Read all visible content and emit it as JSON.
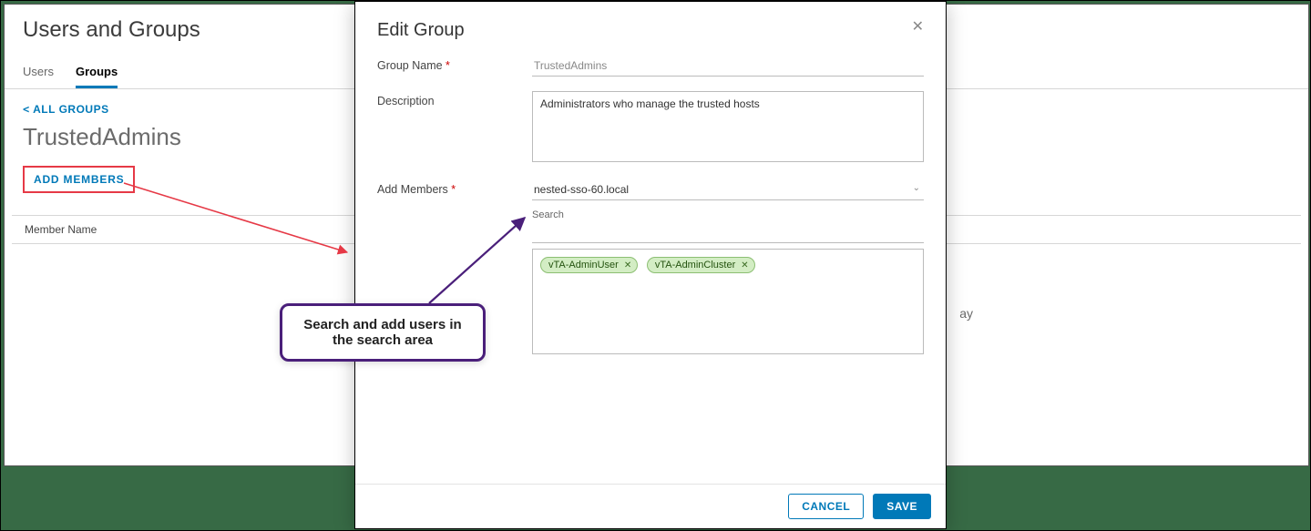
{
  "page": {
    "title": "Users and Groups",
    "tabs": {
      "users": "Users",
      "groups": "Groups"
    },
    "breadcrumb": "ALL GROUPS",
    "group_name": "TrustedAdmins",
    "add_members_btn": "ADD MEMBERS",
    "table": {
      "col_member_name": "Member Name"
    },
    "ghost_text": "ay"
  },
  "modal": {
    "title": "Edit Group",
    "labels": {
      "group_name": "Group Name",
      "description": "Description",
      "add_members": "Add Members"
    },
    "fields": {
      "group_name": "TrustedAdmins",
      "description": "Administrators who manage the trusted hosts",
      "domain": "nested-sso-60.local",
      "search_label": "Search",
      "search_value": ""
    },
    "chips": [
      "vTA-AdminUser",
      "vTA-AdminCluster"
    ],
    "buttons": {
      "cancel": "CANCEL",
      "save": "SAVE"
    }
  },
  "callout": {
    "text": "Search and add users in the search area"
  },
  "colors": {
    "accent": "#0079b8",
    "chip_bg": "#d3edc4",
    "chip_border": "#8cbf73",
    "callout_border": "#4a1f7a",
    "highlight_red": "#e63946"
  }
}
